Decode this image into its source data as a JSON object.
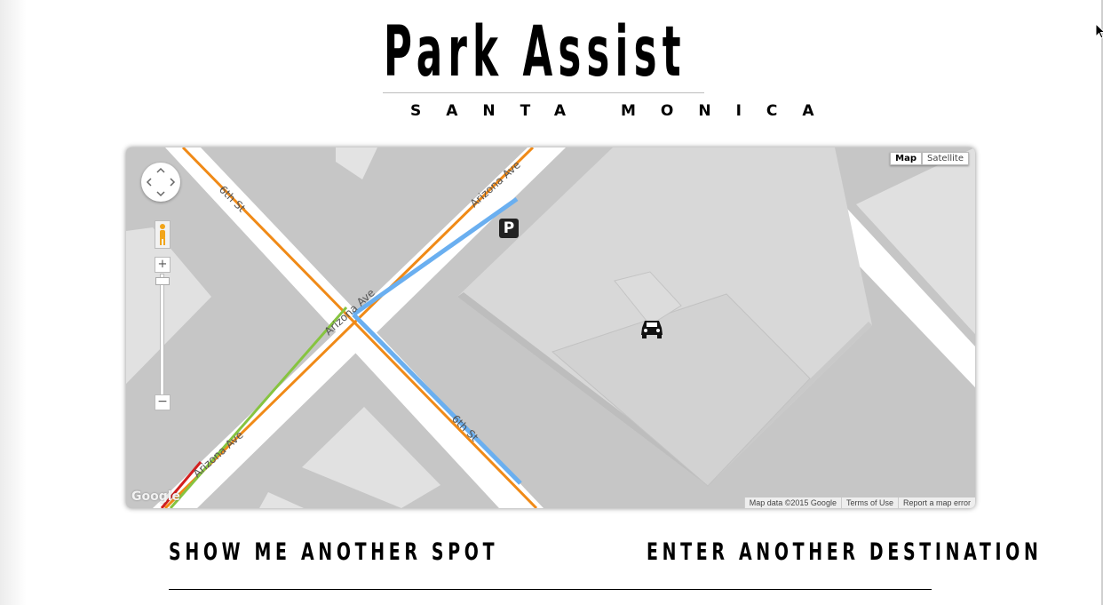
{
  "header": {
    "title": "Park Assist",
    "subtitle": "SANTA MONICA"
  },
  "map": {
    "map_type_buttons": [
      "Map",
      "Satellite"
    ],
    "selected_map_type": "Map",
    "street_labels": [
      "6th St",
      "Arizona Ave",
      "Arizona Ave",
      "6th St",
      "Arizona Ave"
    ],
    "markers": [
      "parking-icon",
      "car-icon"
    ],
    "parking_glyph": "P",
    "zoom_in": "+",
    "zoom_out": "−",
    "logo": "Google",
    "attribution": [
      "Map data ©2015 Google",
      "Terms of Use",
      "Report a map error"
    ]
  },
  "actions": {
    "show_another_spot": "SHOW ME ANOTHER SPOT",
    "enter_destination": "ENTER ANOTHER DESTINATION"
  },
  "colors": {
    "road_orange": "#f08a17",
    "road_blue": "#6aaff0",
    "road_green": "#86c440",
    "road_red": "#d31f1f",
    "map_background": "#c6c6c6"
  }
}
